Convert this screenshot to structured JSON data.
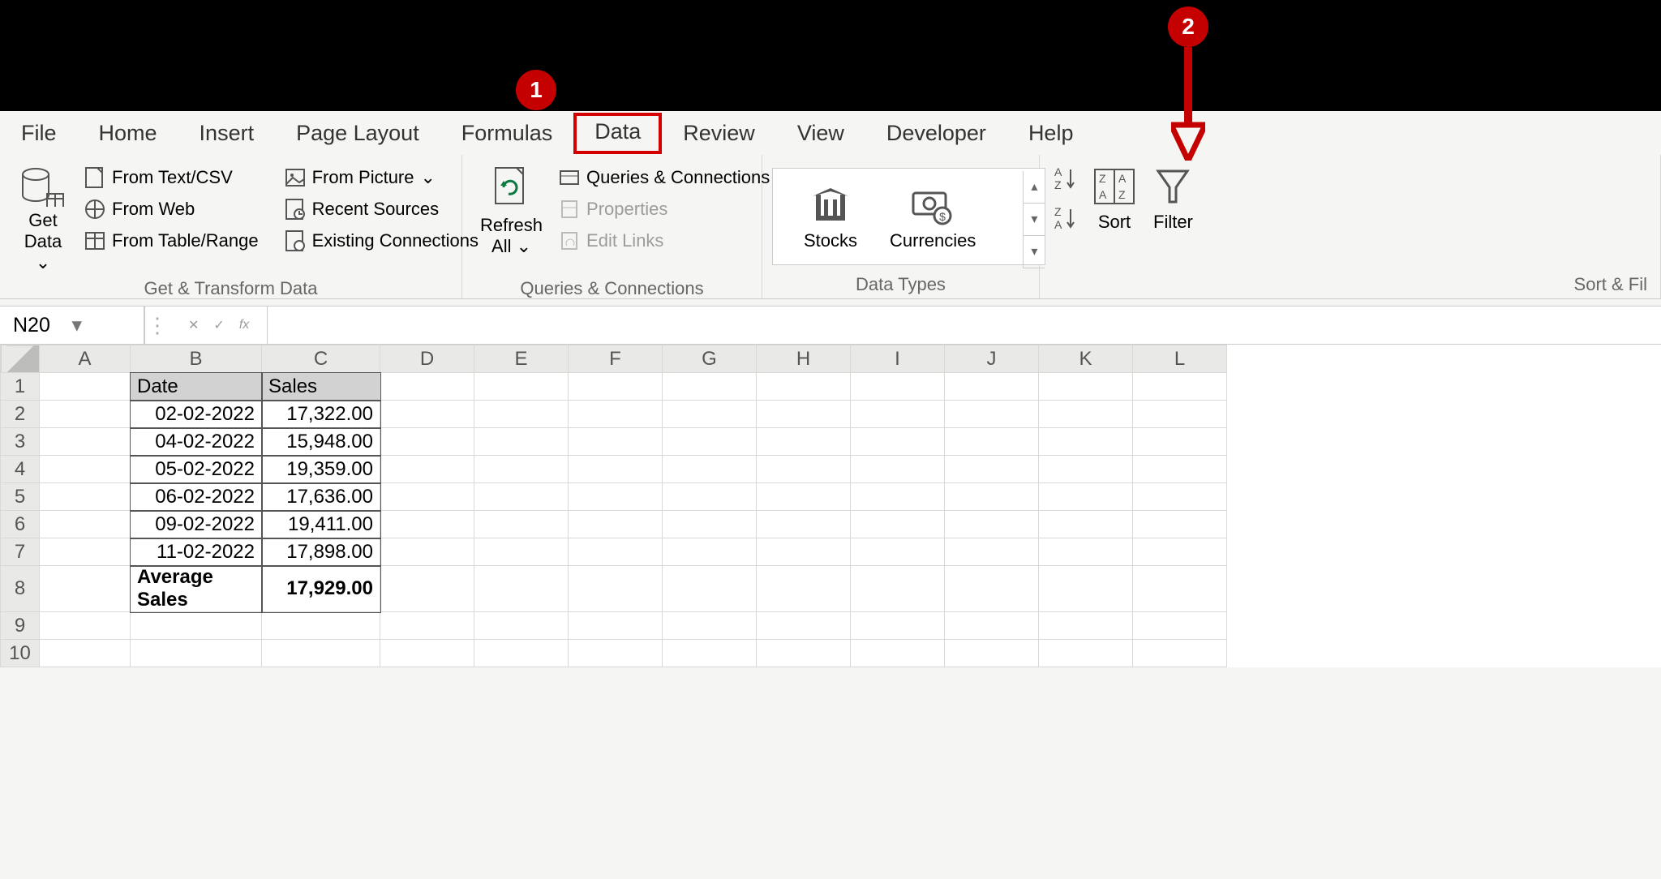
{
  "annotations": {
    "badge1": "1",
    "badge2": "2"
  },
  "ribbon": {
    "tabs": [
      "File",
      "Home",
      "Insert",
      "Page Layout",
      "Formulas",
      "Data",
      "Review",
      "View",
      "Developer",
      "Help"
    ],
    "active_tab": "Data"
  },
  "groups": {
    "get_transform": {
      "label": "Get & Transform Data",
      "get_data": "Get\nData",
      "items_col1": [
        "From Text/CSV",
        "From Web",
        "From Table/Range"
      ],
      "items_col2": [
        "From Picture",
        "Recent Sources",
        "Existing Connections"
      ]
    },
    "queries": {
      "label": "Queries & Connections",
      "refresh_all": "Refresh\nAll",
      "items": [
        "Queries & Connections",
        "Properties",
        "Edit Links"
      ]
    },
    "data_types": {
      "label": "Data Types",
      "stocks": "Stocks",
      "currencies": "Currencies"
    },
    "sort_filter": {
      "label": "Sort & Filter",
      "sort": "Sort",
      "filter": "Filter"
    }
  },
  "formula_bar": {
    "name": "N20",
    "formula": ""
  },
  "sheet": {
    "columns": [
      "A",
      "B",
      "C",
      "D",
      "E",
      "F",
      "G",
      "H",
      "I",
      "J",
      "K",
      "L"
    ],
    "row_numbers": [
      "1",
      "2",
      "3",
      "4",
      "5",
      "6",
      "7",
      "8",
      "9",
      "10"
    ],
    "header_row": {
      "B": "Date",
      "C": "Sales"
    },
    "rows": [
      {
        "B": "02-02-2022",
        "C": "17,322.00"
      },
      {
        "B": "04-02-2022",
        "C": "15,948.00"
      },
      {
        "B": "05-02-2022",
        "C": "19,359.00"
      },
      {
        "B": "06-02-2022",
        "C": "17,636.00"
      },
      {
        "B": "09-02-2022",
        "C": "19,411.00"
      },
      {
        "B": "11-02-2022",
        "C": "17,898.00"
      }
    ],
    "footer": {
      "B": "Average Sales",
      "C": "17,929.00"
    }
  }
}
